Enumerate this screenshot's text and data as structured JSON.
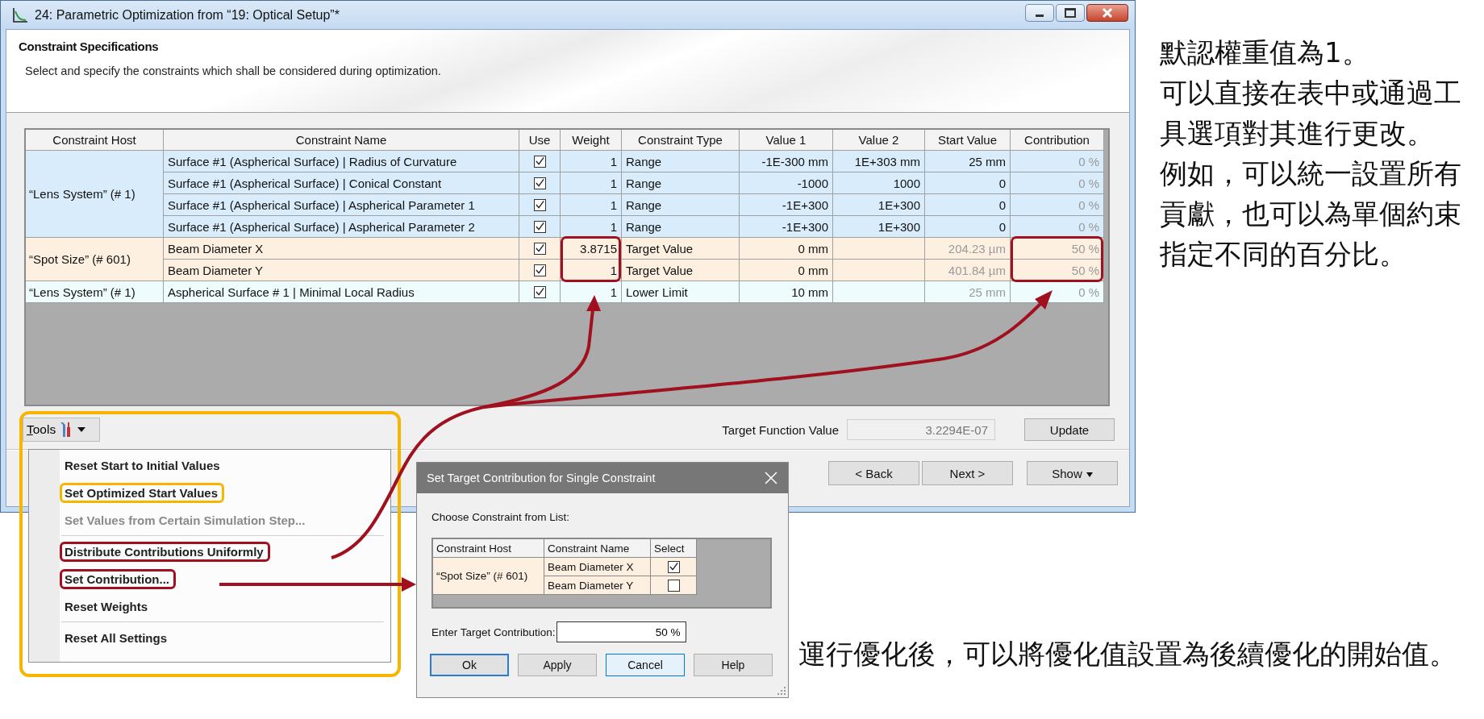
{
  "window": {
    "title": "24: Parametric Optimization from “19: Optical Setup”*"
  },
  "header": {
    "title": "Constraint Specifications",
    "description": "Select and specify the constraints which shall be considered during optimization."
  },
  "table": {
    "columns": [
      "Constraint Host",
      "Constraint Name",
      "Use",
      "Weight",
      "Constraint Type",
      "Value 1",
      "Value 2",
      "Start Value",
      "Contribution"
    ],
    "groups": [
      {
        "host": "“Lens System” (# 1)",
        "color": "#d9ecfb",
        "highlighted": false,
        "rows": [
          {
            "name": "Surface #1 (Aspherical Surface) | Radius of Curvature",
            "use": true,
            "weight": "1",
            "type": "Range",
            "value1": "-1E-300 mm",
            "value2": "1E+303 mm",
            "start": "25 mm",
            "start_greyed": false,
            "contribution": "0 %"
          },
          {
            "name": "Surface #1 (Aspherical Surface) | Conical Constant",
            "use": true,
            "weight": "1",
            "type": "Range",
            "value1": "-1000",
            "value2": "1000",
            "start": "0",
            "start_greyed": false,
            "contribution": "0 %"
          },
          {
            "name": "Surface #1 (Aspherical Surface) | Aspherical Parameter 1",
            "use": true,
            "weight": "1",
            "type": "Range",
            "value1": "-1E+300",
            "value2": "1E+300",
            "start": "0",
            "start_greyed": false,
            "contribution": "0 %"
          },
          {
            "name": "Surface #1 (Aspherical Surface) | Aspherical Parameter 2",
            "use": true,
            "weight": "1",
            "type": "Range",
            "value1": "-1E+300",
            "value2": "1E+300",
            "start": "0",
            "start_greyed": false,
            "contribution": "0 %"
          }
        ]
      },
      {
        "host": "“Spot Size” (# 601)",
        "color": "#fdf0e1",
        "highlighted": true,
        "rows": [
          {
            "name": "Beam Diameter X",
            "use": true,
            "weight": "3.8715",
            "type": "Target Value",
            "value1": "0 mm",
            "start": "204.23 µm",
            "start_greyed": true,
            "contribution": "50 %"
          },
          {
            "name": "Beam Diameter Y",
            "use": true,
            "weight": "1",
            "type": "Target Value",
            "value1": "0 mm",
            "start": "401.84 µm",
            "start_greyed": true,
            "contribution": "50 %"
          }
        ]
      },
      {
        "host": "“Lens System” (# 1)",
        "color": "#effcfd",
        "highlighted": false,
        "rows": [
          {
            "name": "Aspherical Surface # 1 | Minimal Local Radius",
            "use": true,
            "weight": "1",
            "type": "Lower Limit",
            "value1": "10 mm",
            "start": "25 mm",
            "start_greyed": true,
            "contribution": "0 %"
          }
        ]
      }
    ]
  },
  "tools": {
    "label": "Tools",
    "highlighted": true,
    "color": "#f7b500"
  },
  "target_function": {
    "label": "Target Function Value",
    "value": "3.2294E-07",
    "button": "Update"
  },
  "nav_buttons": [
    {
      "label": "< Back",
      "kind": "plain"
    },
    {
      "label": "Next >",
      "kind": "plain"
    },
    {
      "label": "Show",
      "kind": "dropdown"
    }
  ],
  "tools_menu": [
    {
      "kind": "item",
      "label": "Reset Start to Initial Values",
      "disabled": false,
      "highlighted": false
    },
    {
      "kind": "item",
      "label": "Set Optimized Start Values",
      "disabled": false,
      "highlighted": true,
      "color": "#f7b500"
    },
    {
      "kind": "item",
      "label": "Set Values from Certain Simulation Step...",
      "disabled": true,
      "highlighted": false
    },
    {
      "kind": "separator"
    },
    {
      "kind": "item",
      "label": "Distribute Contributions Uniformly",
      "disabled": false,
      "highlighted": true,
      "color": "#a0101e"
    },
    {
      "kind": "item",
      "label": "Set Contribution...",
      "disabled": false,
      "highlighted": true,
      "color": "#a0101e"
    },
    {
      "kind": "item",
      "label": "Reset Weights",
      "disabled": false,
      "highlighted": false
    },
    {
      "kind": "separator"
    },
    {
      "kind": "item",
      "label": "Reset All Settings",
      "disabled": false,
      "highlighted": false
    }
  ],
  "dialog": {
    "title": "Set Target Contribution for Single Constraint",
    "prompt": "Choose Constraint from List:",
    "columns": [
      "Constraint Host",
      "Constraint Name",
      "Select"
    ],
    "host": "“Spot Size” (# 601)",
    "rows": [
      {
        "name": "Beam Diameter X",
        "checked": true
      },
      {
        "name": "Beam Diameter Y",
        "checked": false
      }
    ],
    "field_label": "Enter Target Contribution:",
    "field_value": "50 %",
    "buttons": [
      {
        "label": "Ok",
        "kind": "default"
      },
      {
        "label": "Apply",
        "kind": "normal"
      },
      {
        "label": "Cancel",
        "kind": "focused"
      },
      {
        "label": "Help",
        "kind": "normal"
      }
    ]
  },
  "notes": [
    "默認權重值為1。",
    "可以直接在表中或通過工具選項對其進行更改。",
    "例如，可以統一設置所有貢獻，也可以為單個約束指定不同的百分比。"
  ],
  "bottom_note": "運行優化後，可以將優化值設置為後續優化的開始值。"
}
